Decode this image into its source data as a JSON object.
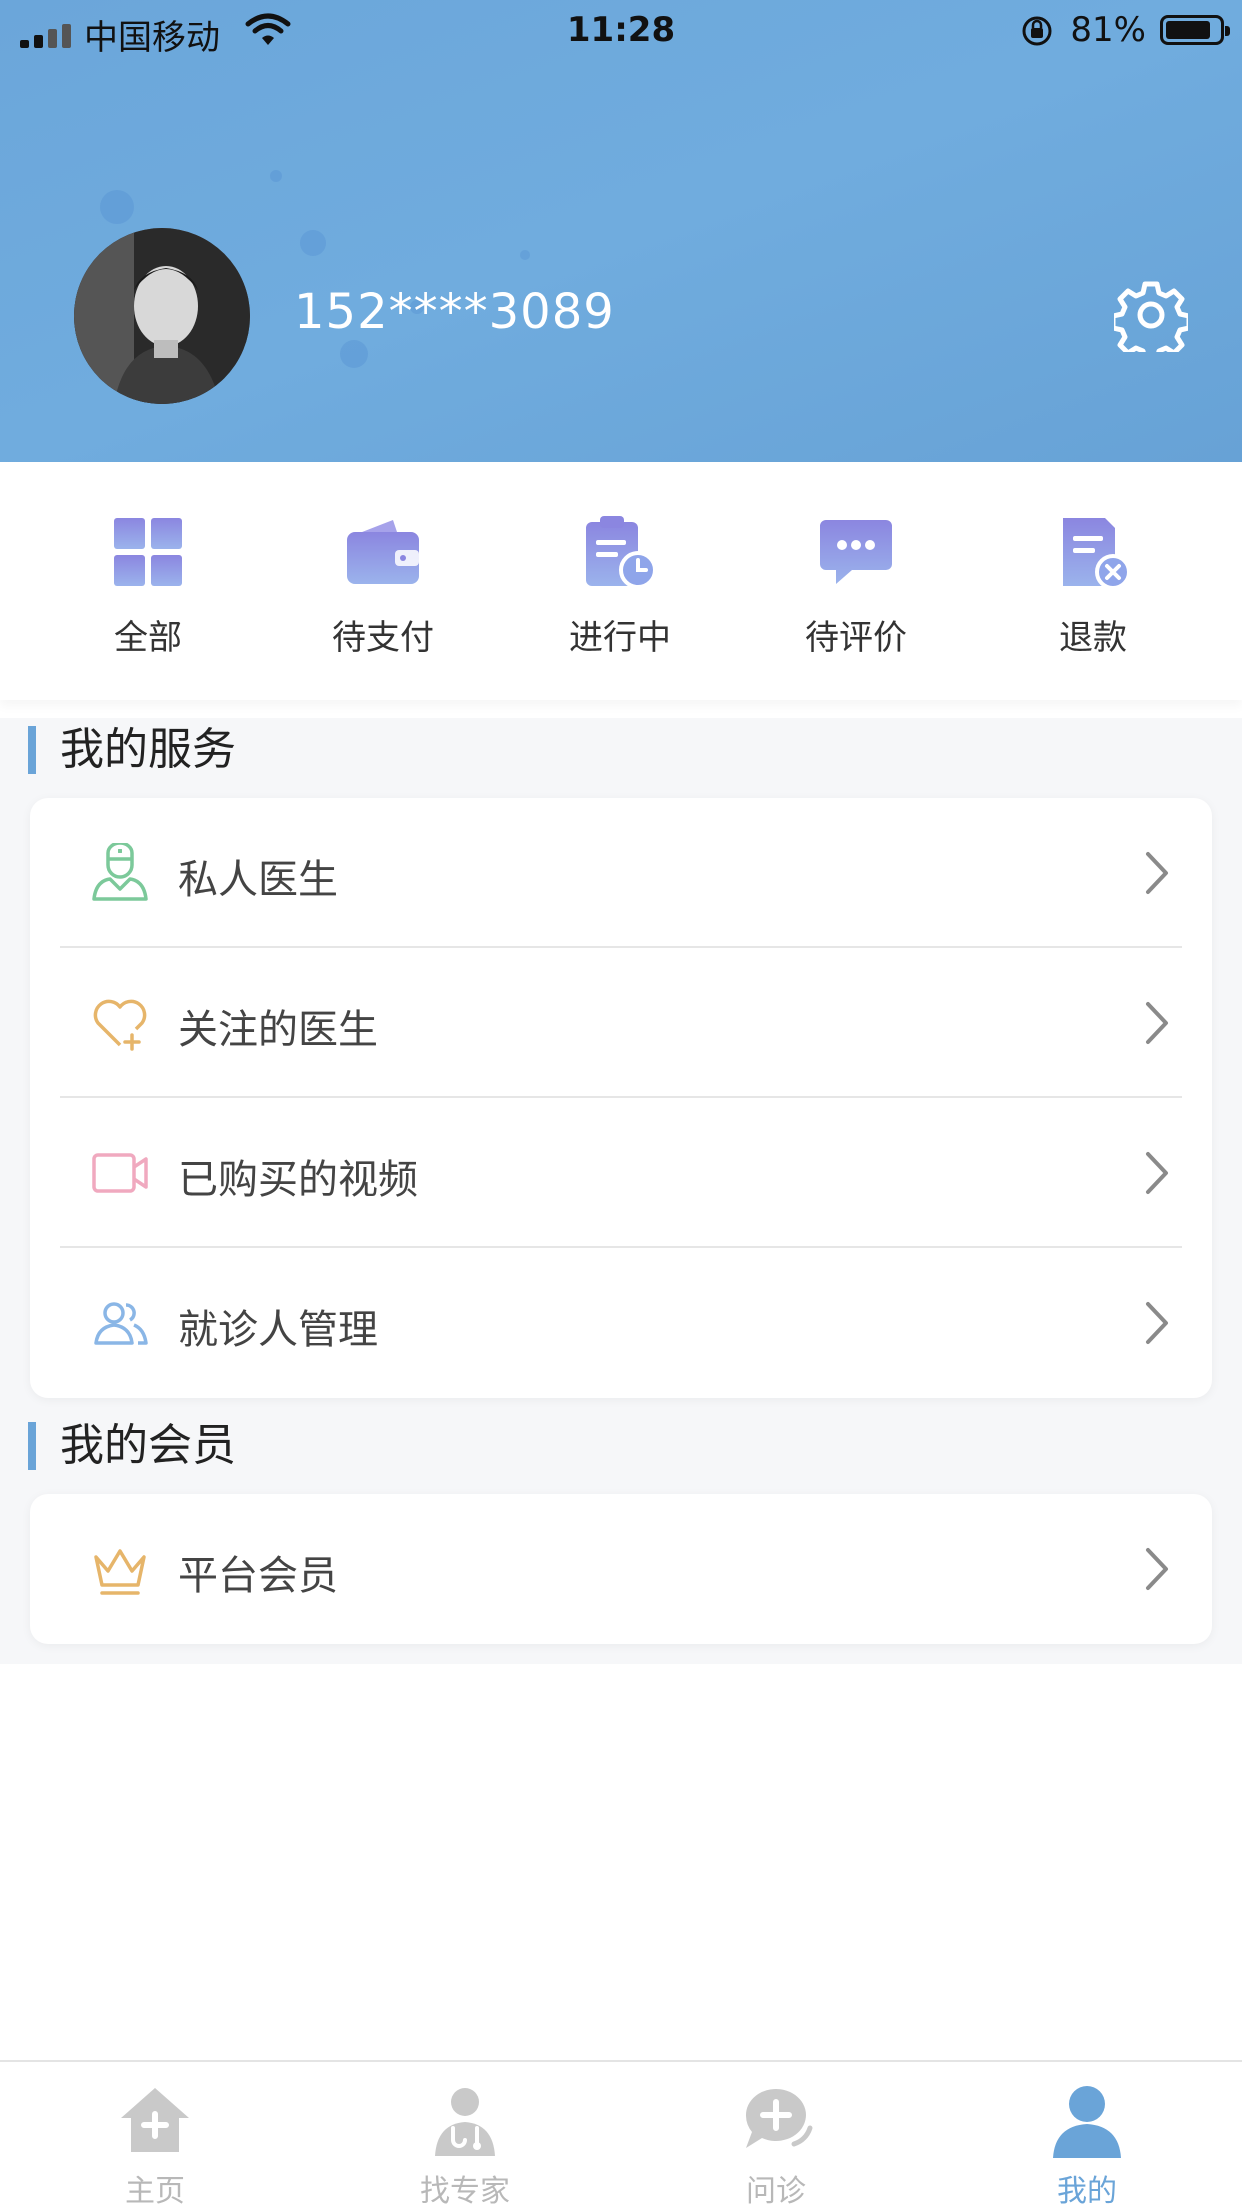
{
  "status_bar": {
    "carrier": "中国移动",
    "time": "11:28",
    "battery": "81%"
  },
  "profile": {
    "phone": "152****3089"
  },
  "orders": [
    {
      "label": "全部",
      "icon": "grid-icon"
    },
    {
      "label": "待支付",
      "icon": "wallet-icon"
    },
    {
      "label": "进行中",
      "icon": "clipboard-clock-icon"
    },
    {
      "label": "待评价",
      "icon": "chat-bubble-icon"
    },
    {
      "label": "退款",
      "icon": "refund-doc-icon"
    }
  ],
  "services": {
    "title": "我的服务",
    "items": [
      {
        "label": "私人医生",
        "icon": "doctor-icon",
        "color": "#7cc99a"
      },
      {
        "label": "关注的医生",
        "icon": "heart-plus-icon",
        "color": "#e6b56a"
      },
      {
        "label": "已购买的视频",
        "icon": "video-camera-icon",
        "color": "#f0a9bf"
      },
      {
        "label": "就诊人管理",
        "icon": "patients-icon",
        "color": "#8ab6e6"
      }
    ]
  },
  "membership": {
    "title": "我的会员",
    "items": [
      {
        "label": "平台会员",
        "icon": "crown-icon",
        "color": "#e6b56a"
      }
    ]
  },
  "tabbar": [
    {
      "label": "主页",
      "icon": "home-icon"
    },
    {
      "label": "找专家",
      "icon": "expert-icon"
    },
    {
      "label": "问诊",
      "icon": "consult-icon"
    },
    {
      "label": "我的",
      "icon": "user-icon"
    }
  ],
  "colors": {
    "header": "#6fa9dc",
    "accent": "#6aa4d8",
    "order_icon": "#8a9ae6"
  }
}
